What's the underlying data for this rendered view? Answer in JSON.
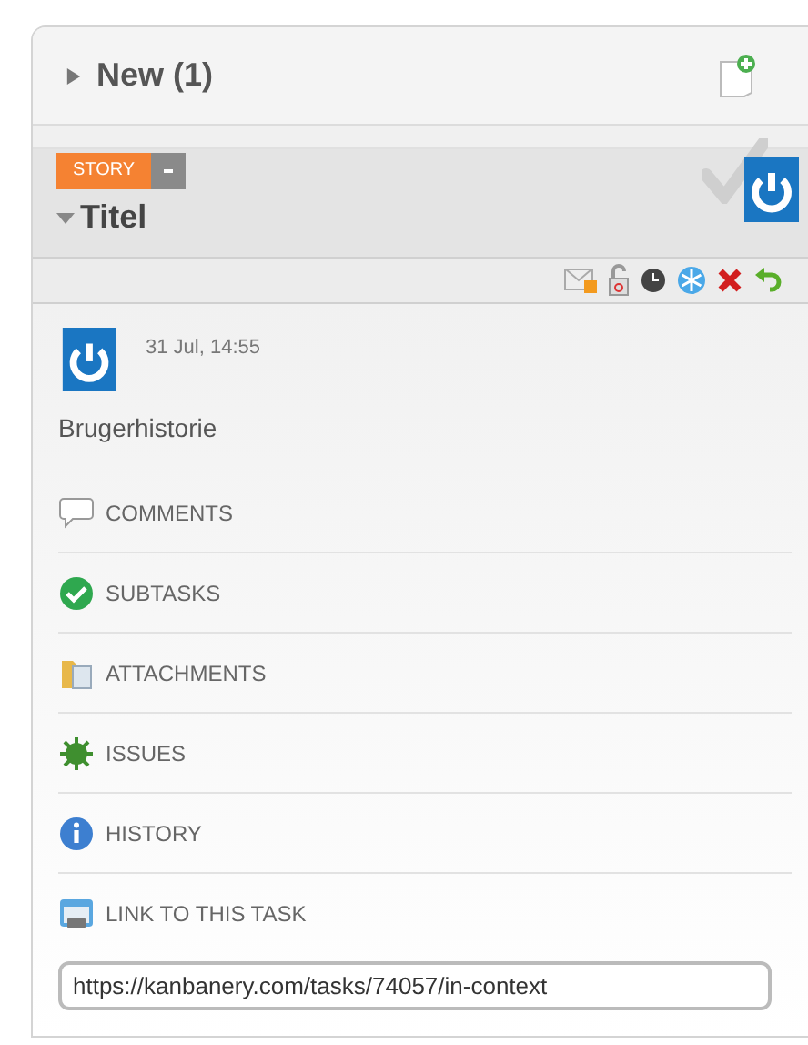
{
  "column": {
    "title": "New (1)",
    "expanded": false
  },
  "task": {
    "type_badge": "STORY",
    "title": "Titel",
    "expanded": true,
    "timestamp": "31 Jul, 14:55",
    "description": "Brugerhistorie",
    "sections": [
      {
        "kind": "comments",
        "label": "COMMENTS"
      },
      {
        "kind": "subtasks",
        "label": "SUBTASKS"
      },
      {
        "kind": "attachments",
        "label": "ATTACHMENTS"
      },
      {
        "kind": "issues",
        "label": "ISSUES"
      },
      {
        "kind": "history",
        "label": "HISTORY"
      },
      {
        "kind": "link",
        "label": "LINK TO THIS TASK"
      }
    ],
    "link_value": "https://kanbanery.com/tasks/74057/in-context"
  }
}
